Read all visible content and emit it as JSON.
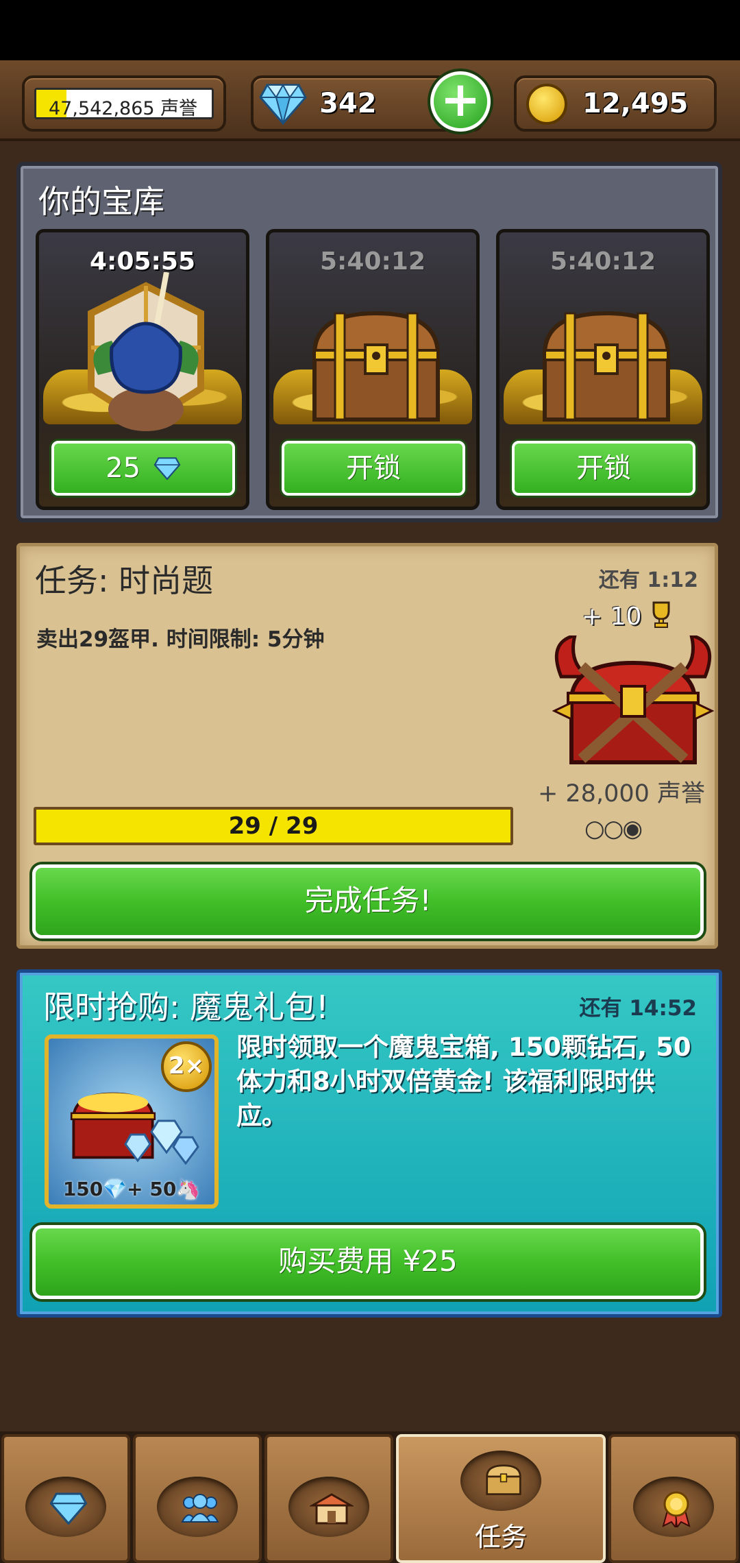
{
  "hud": {
    "fame_text": "47,542,865 声誉",
    "fame_progress": 0.17,
    "gems": "342",
    "plus": "+",
    "gold": "12,495"
  },
  "vault": {
    "title": "你的宝库",
    "slots": [
      {
        "timer": "4:05:55",
        "button": "25",
        "icon": "hooded-goblin-icon"
      },
      {
        "timer": "5:40:12",
        "button": "开锁",
        "icon": "treasure-chest-icon"
      },
      {
        "timer": "5:40:12",
        "button": "开锁",
        "icon": "treasure-chest-icon"
      }
    ]
  },
  "quest": {
    "title": "任务: 时尚题",
    "time_left": "还有 1:12",
    "description": "卖出29盔甲. 时间限制: 5分钟",
    "reward_trophies": "+ 10",
    "reward_fame": "+ 28,000 声誉",
    "dots": "○○◉",
    "progress_text": "29 / 29",
    "progress": 1.0,
    "button": "完成任务!"
  },
  "promo": {
    "title": "限时抢购: 魔鬼礼包!",
    "time_left": "还有 14:52",
    "badge": "2×",
    "caption": "150💎+ 50🦄",
    "description": "限时领取一个魔鬼宝箱, 150颗钻石, 50体力和8小时双倍黄金! 该福利限时供应。",
    "button": "购买费用 ¥25"
  },
  "nav": {
    "items": [
      {
        "icon": "gem-icon"
      },
      {
        "icon": "people-icon"
      },
      {
        "icon": "shop-icon"
      },
      {
        "icon": "chest-icon",
        "label": "任务"
      },
      {
        "icon": "medal-icon"
      }
    ]
  },
  "colors": {
    "green_button": "#41bf28",
    "parchment": "#d9c192",
    "promo_teal": "#10a2b4",
    "progress_yellow": "#f5e400"
  }
}
